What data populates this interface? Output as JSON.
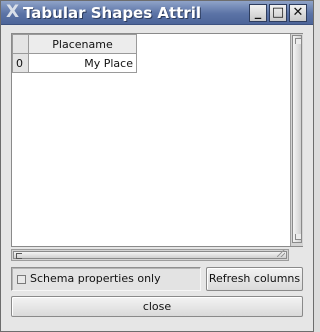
{
  "window": {
    "title": "Tabular Shapes Attril",
    "controls": {
      "minimize": "_",
      "maximize": "□",
      "close": "✕"
    },
    "app_icon": "x-logo-icon"
  },
  "table": {
    "columns": [
      "Placename"
    ],
    "rows": [
      {
        "index": "0",
        "cells": [
          "My Place"
        ]
      }
    ]
  },
  "schema_checkbox": {
    "label": "Schema properties only",
    "checked": false
  },
  "buttons": {
    "refresh": "Refresh columns",
    "close": "close"
  }
}
